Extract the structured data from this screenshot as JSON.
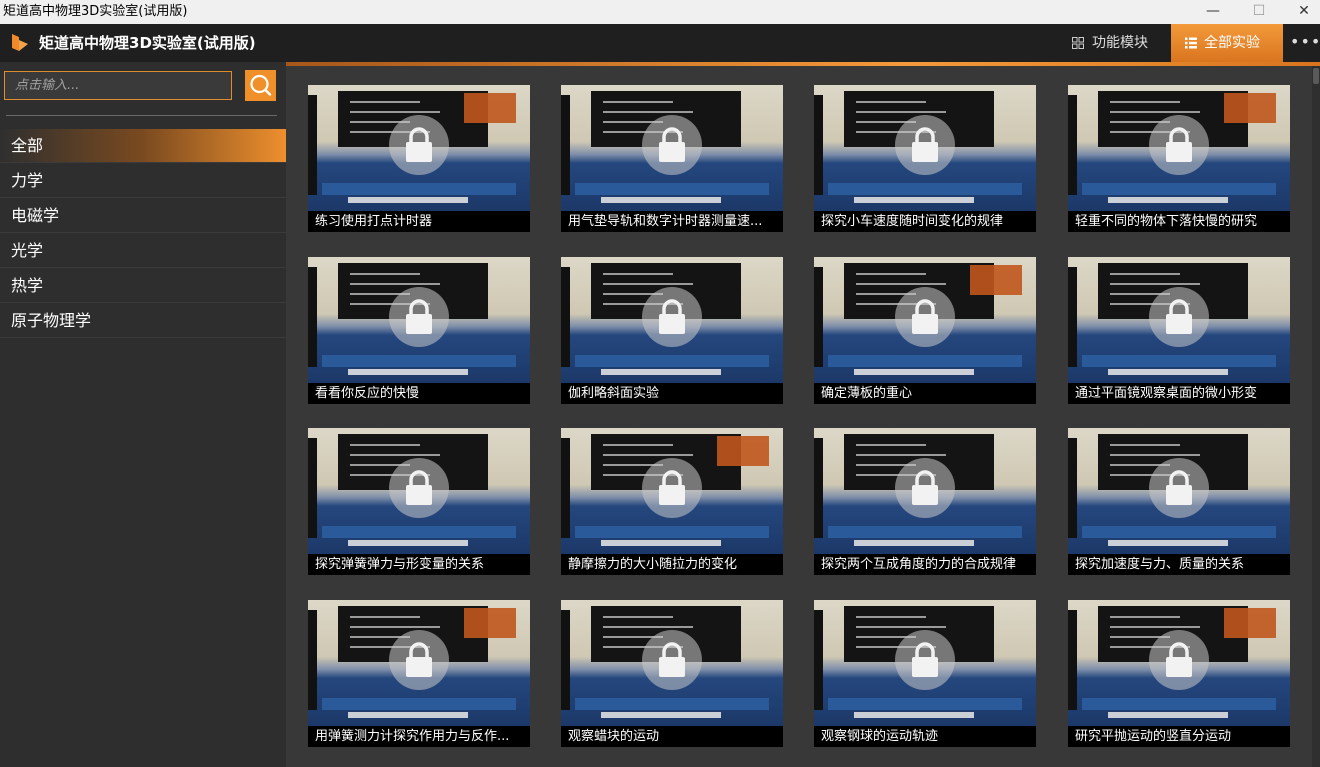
{
  "window": {
    "title": "矩道高中物理3D实验室(试用版)",
    "controls": {
      "minimize": "—",
      "maximize": "☐",
      "close": "✕"
    }
  },
  "header": {
    "app_title": "矩道高中物理3D实验室(试用版)",
    "nav_modules": "功能模块",
    "nav_all": "全部实验",
    "more": "•••"
  },
  "sidebar": {
    "search_placeholder": "点击输入...",
    "categories": [
      "全部",
      "力学",
      "电磁学",
      "光学",
      "热学",
      "原子物理学"
    ],
    "active_index": 0
  },
  "experiments": [
    "练习使用打点计时器",
    "用气垫导轨和数字计时器测量速...",
    "探究小车速度随时间变化的规律",
    "轻重不同的物体下落快慢的研究",
    "看看你反应的快慢",
    "伽利略斜面实验",
    "确定薄板的重心",
    "通过平面镜观察桌面的微小形变",
    "探究弹簧弹力与形变量的关系",
    "静摩擦力的大小随拉力的变化",
    "探究两个互成角度的力的合成规律",
    "探究加速度与力、质量的关系",
    "用弹簧测力计探究作用力与反作...",
    "观察蜡块的运动",
    "观察钢球的运动轨迹",
    "研究平抛运动的竖直分运动"
  ],
  "colors": {
    "accent": "#f0902a",
    "background": "#383838",
    "sidebar": "#2e2e2e",
    "header": "#1f1f1f"
  },
  "icons": {
    "logo": "brand-logo-icon",
    "search": "search-icon",
    "lock": "lock-icon",
    "grid": "grid-icon",
    "list": "list-icon"
  }
}
